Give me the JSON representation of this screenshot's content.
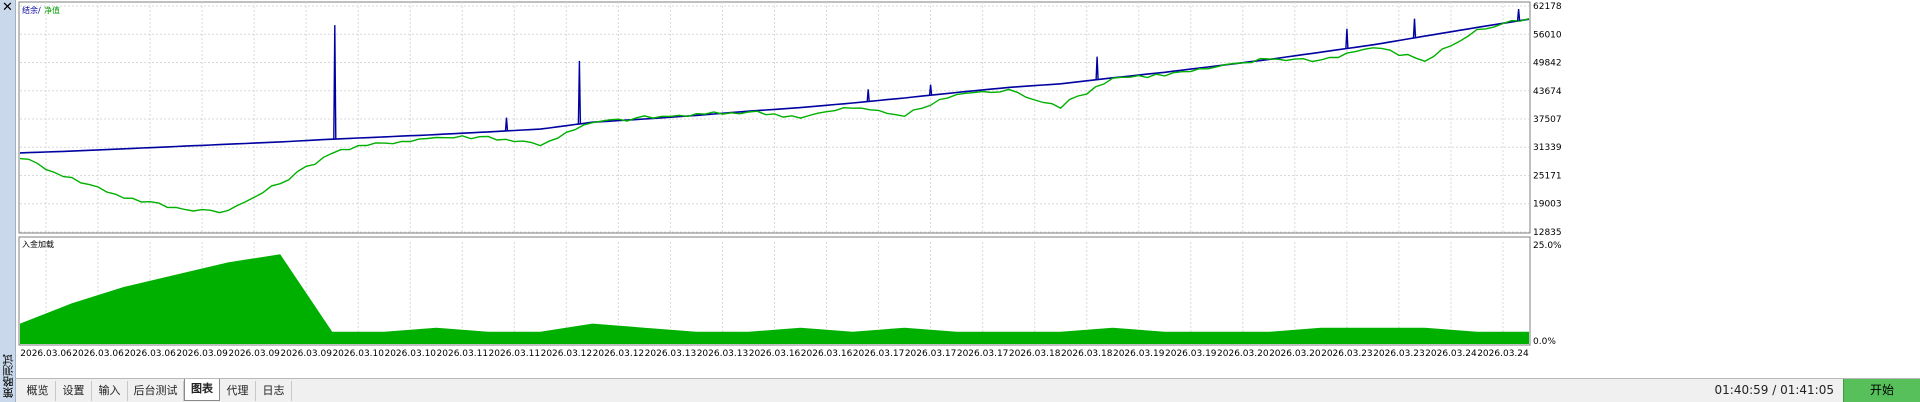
{
  "side_panel": {
    "close_glyph": "✕",
    "title": "策略测试"
  },
  "legend": {
    "balance_label": "结余",
    "separator": "/",
    "equity_label": "净值",
    "balance_color": "#0000a0",
    "equity_color": "#00b000"
  },
  "deposit_panel": {
    "label": "入金加载"
  },
  "tabs": [
    {
      "label": "概览",
      "active": false
    },
    {
      "label": "设置",
      "active": false
    },
    {
      "label": "输入",
      "active": false
    },
    {
      "label": "后台测试",
      "active": false
    },
    {
      "label": "图表",
      "active": true
    },
    {
      "label": "代理",
      "active": false
    },
    {
      "label": "日志",
      "active": false
    }
  ],
  "status": {
    "time_text": "01:40:59 / 01:41:05",
    "start_label": "开始"
  },
  "chart_data": [
    {
      "type": "line",
      "title": "",
      "ylim": [
        12835,
        62178
      ],
      "y_ticks": [
        "62178",
        "56010",
        "49842",
        "43674",
        "37507",
        "31339",
        "25171",
        "19003",
        "12835"
      ],
      "grid": true,
      "legend_position": "top-left",
      "x": [
        0,
        1,
        2,
        3,
        4,
        5,
        6,
        7,
        8,
        9,
        10,
        11,
        12,
        13,
        14,
        15,
        16,
        17,
        18,
        19,
        20,
        21,
        22,
        23,
        24,
        25,
        26,
        27,
        28,
        29
      ],
      "series": [
        {
          "name": "结余",
          "color": "#0000a0",
          "values": [
            30100,
            30500,
            31000,
            31500,
            32000,
            32500,
            33100,
            33600,
            34100,
            34700,
            35300,
            36800,
            37500,
            38300,
            39200,
            40000,
            41000,
            42100,
            43300,
            44400,
            45200,
            46500,
            47700,
            49100,
            50500,
            52100,
            53700,
            55600,
            57500,
            59300
          ]
        },
        {
          "name": "净值",
          "color": "#00b000",
          "values": [
            29200,
            24500,
            20500,
            18000,
            17400,
            23500,
            30300,
            32300,
            33500,
            33600,
            32000,
            36700,
            37800,
            38400,
            39100,
            38000,
            40000,
            38300,
            43000,
            43700,
            40300,
            46500,
            47200,
            48700,
            50700,
            50400,
            53200,
            50300,
            56900,
            59400
          ]
        }
      ],
      "spikes": [
        {
          "series": "结余",
          "x": 6.05,
          "value": 58000
        },
        {
          "series": "结余",
          "x": 9.35,
          "value": 37800
        },
        {
          "series": "结余",
          "x": 10.75,
          "value": 50200
        },
        {
          "series": "结余",
          "x": 16.3,
          "value": 44000
        },
        {
          "series": "结余",
          "x": 17.5,
          "value": 45000
        },
        {
          "series": "结余",
          "x": 20.7,
          "value": 51100
        },
        {
          "series": "结余",
          "x": 25.5,
          "value": 57200
        },
        {
          "series": "结余",
          "x": 26.8,
          "value": 59400
        },
        {
          "series": "结余",
          "x": 28.8,
          "value": 61500
        }
      ]
    },
    {
      "type": "area",
      "title": "入金加载",
      "ylim": [
        0,
        25
      ],
      "y_ticks": [
        "25.0%",
        "0.0%"
      ],
      "series": [
        {
          "name": "入金加载",
          "color": "#00b000",
          "values": [
            5,
            10,
            14,
            17,
            20,
            22,
            3,
            3,
            4,
            3,
            3,
            5,
            4,
            3,
            3,
            4,
            3,
            4,
            3,
            3,
            3,
            4,
            3,
            3,
            3,
            4,
            4,
            4,
            3,
            3
          ]
        }
      ]
    }
  ],
  "x_labels": [
    "2026.03.06",
    "2026.03.06",
    "2026.03.06",
    "2026.03.09",
    "2026.03.09",
    "2026.03.09",
    "2026.03.10",
    "2026.03.10",
    "2026.03.11",
    "2026.03.11",
    "2026.03.12",
    "2026.03.12",
    "2026.03.13",
    "2026.03.13",
    "2026.03.16",
    "2026.03.16",
    "2026.03.17",
    "2026.03.17",
    "2026.03.17",
    "2026.03.18",
    "2026.03.18",
    "2026.03.19",
    "2026.03.19",
    "2026.03.20",
    "2026.03.20",
    "2026.03.23",
    "2026.03.23",
    "2026.03.24",
    "2026.03.24"
  ]
}
